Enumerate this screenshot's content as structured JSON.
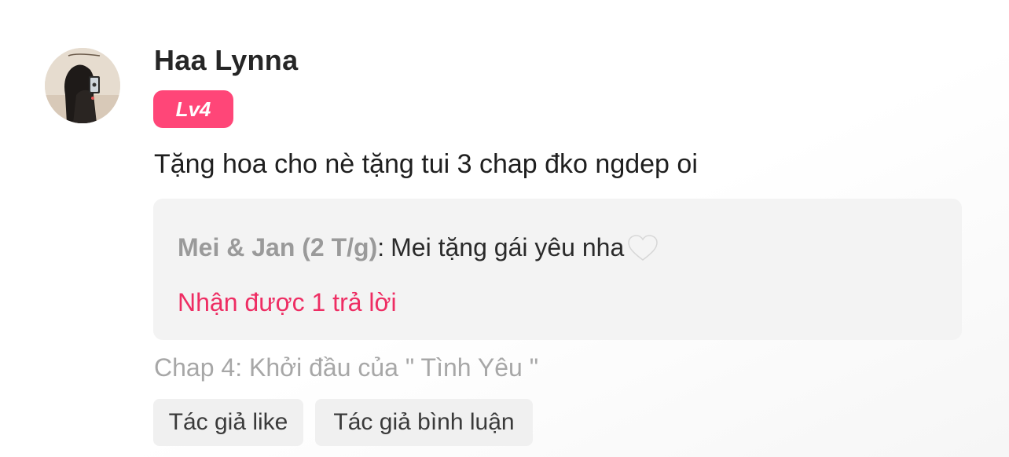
{
  "comment": {
    "user_name": "Haa Lynna",
    "level": "Lv4",
    "text": "Tặng hoa cho nè tặng tui 3 chap đko ngdep oi",
    "reply_preview": {
      "author": "Mei & Jan (2 T/g)",
      "separator": ":",
      "text": "Mei tặng gái yêu nha",
      "emoji": "white-heart-icon"
    },
    "replies_count_text": "Nhận được 1 trả lời",
    "chapter": "Chap 4: Khởi đầu của \" Tình Yêu \"",
    "tags": [
      "Tác giả like",
      "Tác giả bình luận"
    ]
  },
  "colors": {
    "level_badge": "#ff4678",
    "replies_link": "#ee2d63",
    "reply_box_bg": "#f3f3f3",
    "tag_bg": "#f0f0f0",
    "muted_text": "#a7a7a7"
  }
}
